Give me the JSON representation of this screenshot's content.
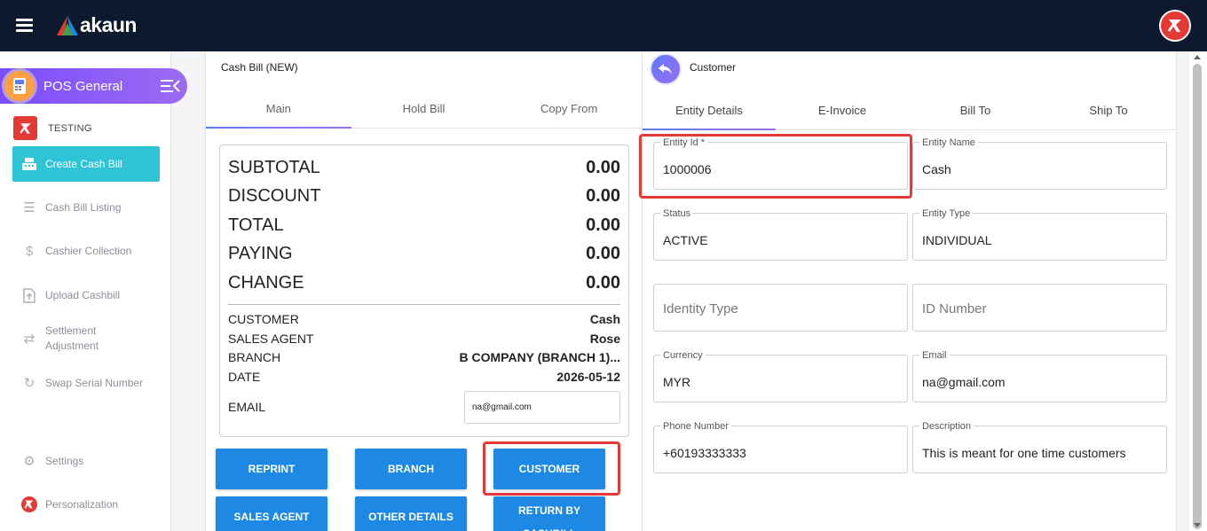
{
  "topbar": {
    "brand": "akaun"
  },
  "sidebar": {
    "app_title": "POS General",
    "org_name": "TESTING",
    "items": [
      {
        "label": "Create Cash Bill"
      },
      {
        "label": "Cash Bill Listing"
      },
      {
        "label": "Cashier Collection"
      },
      {
        "label": "Upload Cashbill"
      },
      {
        "label_line1": "Settlement",
        "label_line2": "Adjustment"
      },
      {
        "label": "Swap Serial Number"
      },
      {
        "label": "Settings"
      },
      {
        "label": "Personalization"
      }
    ]
  },
  "cashbill": {
    "title": "Cash Bill (NEW)",
    "tabs": [
      "Main",
      "Hold Bill",
      "Copy From"
    ],
    "summary": [
      {
        "label": "SUBTOTAL",
        "value": "0.00"
      },
      {
        "label": "DISCOUNT",
        "value": "0.00"
      },
      {
        "label": "TOTAL",
        "value": "0.00"
      },
      {
        "label": "PAYING",
        "value": "0.00"
      },
      {
        "label": "CHANGE",
        "value": "0.00"
      }
    ],
    "info": [
      {
        "label": "CUSTOMER",
        "value": "Cash"
      },
      {
        "label": "SALES AGENT",
        "value": "Rose"
      },
      {
        "label": "BRANCH",
        "value": "B COMPANY (BRANCH 1)..."
      },
      {
        "label": "DATE",
        "value": "2026-05-12"
      }
    ],
    "email_label": "EMAIL",
    "email_value": "na@gmail.com",
    "buttons": {
      "reprint": "REPRINT",
      "branch": "BRANCH",
      "customer": "CUSTOMER",
      "sales_agent": "SALES AGENT",
      "other_details": "OTHER DETAILS",
      "return_by_cashbill": "RETURN BY CASHBILL"
    }
  },
  "customer": {
    "title": "Customer",
    "tabs": [
      "Entity Details",
      "E-Invoice",
      "Bill To",
      "Ship To"
    ],
    "fields": {
      "entity_id": {
        "label": "Entity Id *",
        "value": "1000006"
      },
      "entity_name": {
        "label": "Entity Name",
        "value": "Cash"
      },
      "status": {
        "label": "Status",
        "value": "ACTIVE"
      },
      "entity_type": {
        "label": "Entity Type",
        "value": "INDIVIDUAL"
      },
      "identity_type": {
        "placeholder": "Identity Type"
      },
      "id_number": {
        "placeholder": "ID Number"
      },
      "currency": {
        "label": "Currency",
        "value": "MYR"
      },
      "email": {
        "label": "Email",
        "value": "na@gmail.com"
      },
      "phone": {
        "label": "Phone Number",
        "value": "+60193333333"
      },
      "description": {
        "label": "Description",
        "value": "This is meant for one time customers"
      }
    }
  },
  "colors": {
    "topbar": "#0b1a2e",
    "accent": "#2ec4d6",
    "button": "#1e88e5",
    "highlight": "#e53935",
    "purple": "#8b5cf6"
  }
}
